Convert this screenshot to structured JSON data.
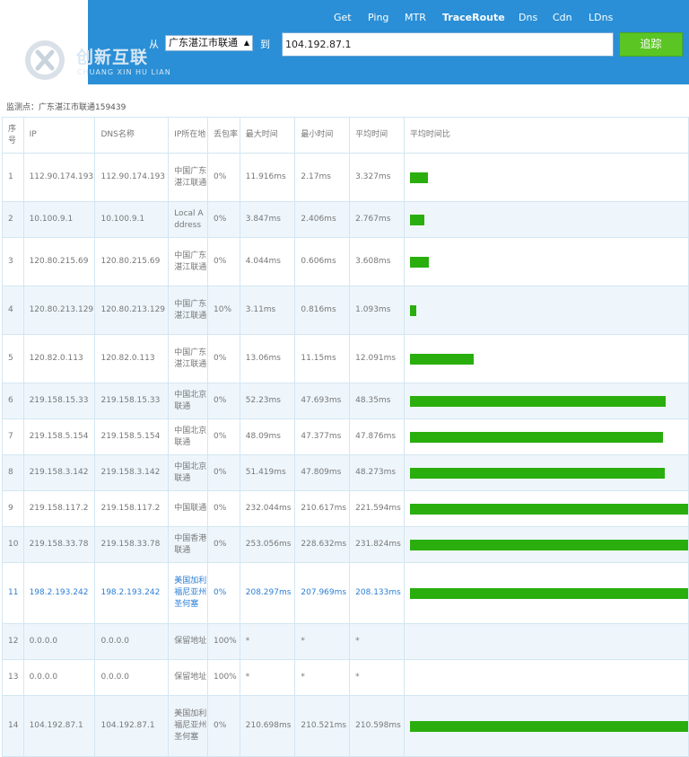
{
  "nav": {
    "items": [
      "Get",
      "Ping",
      "MTR",
      "TraceRoute",
      "Dns",
      "Cdn",
      "LDns"
    ],
    "active": "TraceRoute"
  },
  "logo": {
    "cn": "创新互联",
    "en": "CHUANG XIN HU LIAN"
  },
  "form": {
    "from_label": "从",
    "from_value": "广东湛江市联通",
    "to_label": "到",
    "target_ip": "104.192.87.1",
    "button_label": "追踪"
  },
  "monitor_point": "监测点：广东湛江市联通159439",
  "table": {
    "headers": [
      "序号",
      "IP",
      "DNS名称",
      "IP所在地",
      "丢包率",
      "最大时间",
      "最小时间",
      "平均时间",
      "平均时间比"
    ],
    "rows": [
      {
        "no": "1",
        "ip": "112.90.174.193",
        "dns": "112.90.174.193",
        "loc": "中国广东湛江联通",
        "loss": "0%",
        "max": "11.916ms",
        "min": "2.17ms",
        "avg": "3.327ms",
        "ratio": 0.064
      },
      {
        "no": "2",
        "ip": "10.100.9.1",
        "dns": "10.100.9.1",
        "loc": "Local Address",
        "loss": "0%",
        "max": "3.847ms",
        "min": "2.406ms",
        "avg": "2.767ms",
        "ratio": 0.053
      },
      {
        "no": "3",
        "ip": "120.80.215.69",
        "dns": "120.80.215.69",
        "loc": "中国广东湛江联通",
        "loss": "0%",
        "max": "4.044ms",
        "min": "0.606ms",
        "avg": "3.608ms",
        "ratio": 0.069
      },
      {
        "no": "4",
        "ip": "120.80.213.129",
        "dns": "120.80.213.129",
        "loc": "中国广东湛江联通",
        "loss": "10%",
        "max": "3.11ms",
        "min": "0.816ms",
        "avg": "1.093ms",
        "ratio": 0.021
      },
      {
        "no": "5",
        "ip": "120.82.0.113",
        "dns": "120.82.0.113",
        "loc": "中国广东湛江联通",
        "loss": "0%",
        "max": "13.06ms",
        "min": "11.15ms",
        "avg": "12.091ms",
        "ratio": 0.23
      },
      {
        "no": "6",
        "ip": "219.158.15.33",
        "dns": "219.158.15.33",
        "loc": "中国北京联通",
        "loss": "0%",
        "max": "52.23ms",
        "min": "47.693ms",
        "avg": "48.35ms",
        "ratio": 0.92
      },
      {
        "no": "7",
        "ip": "219.158.5.154",
        "dns": "219.158.5.154",
        "loc": "中国北京联通",
        "loss": "0%",
        "max": "48.09ms",
        "min": "47.377ms",
        "avg": "47.876ms",
        "ratio": 0.91
      },
      {
        "no": "8",
        "ip": "219.158.3.142",
        "dns": "219.158.3.142",
        "loc": "中国北京联通",
        "loss": "0%",
        "max": "51.419ms",
        "min": "47.809ms",
        "avg": "48.273ms",
        "ratio": 0.915
      },
      {
        "no": "9",
        "ip": "219.158.117.2",
        "dns": "219.158.117.2",
        "loc": "中国联通",
        "loss": "0%",
        "max": "232.044ms",
        "min": "210.617ms",
        "avg": "221.594ms",
        "ratio": 1.0
      },
      {
        "no": "10",
        "ip": "219.158.33.78",
        "dns": "219.158.33.78",
        "loc": "中国香港联通",
        "loss": "0%",
        "max": "253.056ms",
        "min": "228.632ms",
        "avg": "231.824ms",
        "ratio": 1.0
      },
      {
        "no": "11",
        "ip": "198.2.193.242",
        "dns": "198.2.193.242",
        "loc": "美国加利福尼亚州圣何塞",
        "loss": "0%",
        "max": "208.297ms",
        "min": "207.969ms",
        "avg": "208.133ms",
        "ratio": 1.0,
        "highlight": true
      },
      {
        "no": "12",
        "ip": "0.0.0.0",
        "dns": "0.0.0.0",
        "loc": "保留地址",
        "loss": "100%",
        "max": "*",
        "min": "*",
        "avg": "*",
        "ratio": 0
      },
      {
        "no": "13",
        "ip": "0.0.0.0",
        "dns": "0.0.0.0",
        "loc": "保留地址",
        "loss": "100%",
        "max": "*",
        "min": "*",
        "avg": "*",
        "ratio": 0
      },
      {
        "no": "14",
        "ip": "104.192.87.1",
        "dns": "104.192.87.1",
        "loc": "美国加利福尼亚州圣何塞",
        "loss": "0%",
        "max": "210.698ms",
        "min": "210.521ms",
        "avg": "210.598ms",
        "ratio": 1.0
      }
    ]
  },
  "colors": {
    "header_blue": "#2a8fd6",
    "button_green": "#5bc524",
    "bar_green": "#29ae0d",
    "link_blue": "#2b7fd6",
    "row_alt": "#eef6fc"
  }
}
